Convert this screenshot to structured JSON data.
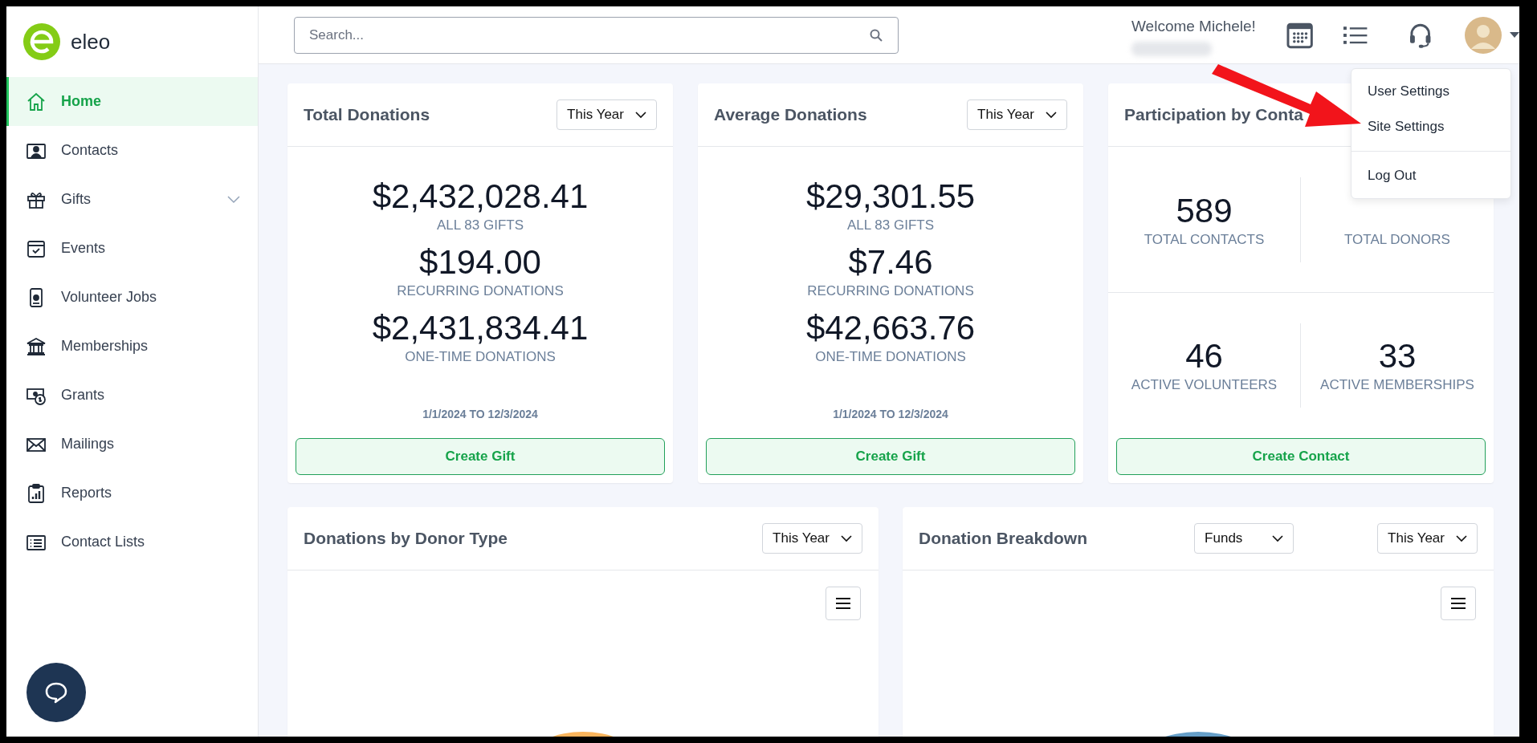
{
  "brand": {
    "name": "eleo"
  },
  "sidebar": {
    "items": [
      {
        "label": "Home",
        "selected": true,
        "kind": "link"
      },
      {
        "label": "Contacts",
        "selected": false,
        "kind": "link"
      },
      {
        "label": "Gifts",
        "selected": false,
        "kind": "group"
      },
      {
        "label": "Events",
        "selected": false,
        "kind": "link"
      },
      {
        "label": "Volunteer Jobs",
        "selected": false,
        "kind": "link"
      },
      {
        "label": "Memberships",
        "selected": false,
        "kind": "link"
      },
      {
        "label": "Grants",
        "selected": false,
        "kind": "link"
      },
      {
        "label": "Mailings",
        "selected": false,
        "kind": "link"
      },
      {
        "label": "Reports",
        "selected": false,
        "kind": "link"
      },
      {
        "label": "Contact Lists",
        "selected": false,
        "kind": "link"
      }
    ]
  },
  "header": {
    "search": {
      "placeholder": "Search..."
    },
    "welcome": "Welcome Michele!"
  },
  "user_menu": {
    "items": [
      "User Settings",
      "Site Settings"
    ],
    "logout": "Log Out"
  },
  "summary_cards": [
    {
      "kind": "amounts",
      "title": "Total Donations",
      "filter": "This Year",
      "stats": [
        {
          "value": "$2,432,028.41",
          "label": "ALL 83 GIFTS"
        },
        {
          "value": "$194.00",
          "label": "RECURRING DONATIONS"
        },
        {
          "value": "$2,431,834.41",
          "label": "ONE-TIME DONATIONS"
        }
      ],
      "date_range": "1/1/2024 TO 12/3/2024",
      "action": "Create Gift"
    },
    {
      "kind": "amounts",
      "title": "Average Donations",
      "filter": "This Year",
      "stats": [
        {
          "value": "$29,301.55",
          "label": "ALL 83 GIFTS"
        },
        {
          "value": "$7.46",
          "label": "RECURRING DONATIONS"
        },
        {
          "value": "$42,663.76",
          "label": "ONE-TIME DONATIONS"
        }
      ],
      "date_range": "1/1/2024 TO 12/3/2024",
      "action": "Create Gift"
    },
    {
      "kind": "grid",
      "title": "Participation by Conta",
      "stats": [
        {
          "value": "589",
          "label": "TOTAL CONTACTS"
        },
        {
          "label": "TOTAL DONORS"
        },
        {
          "value": "46",
          "label": "ACTIVE VOLUNTEERS"
        },
        {
          "value": "33",
          "label": "ACTIVE MEMBERSHIPS"
        }
      ],
      "action": "Create Contact"
    }
  ],
  "chart_cards": [
    {
      "title": "Donations by Donor Type",
      "filters": [
        "This Year"
      ]
    },
    {
      "title": "Donation Breakdown",
      "filters": [
        "Funds",
        "This Year"
      ]
    }
  ]
}
